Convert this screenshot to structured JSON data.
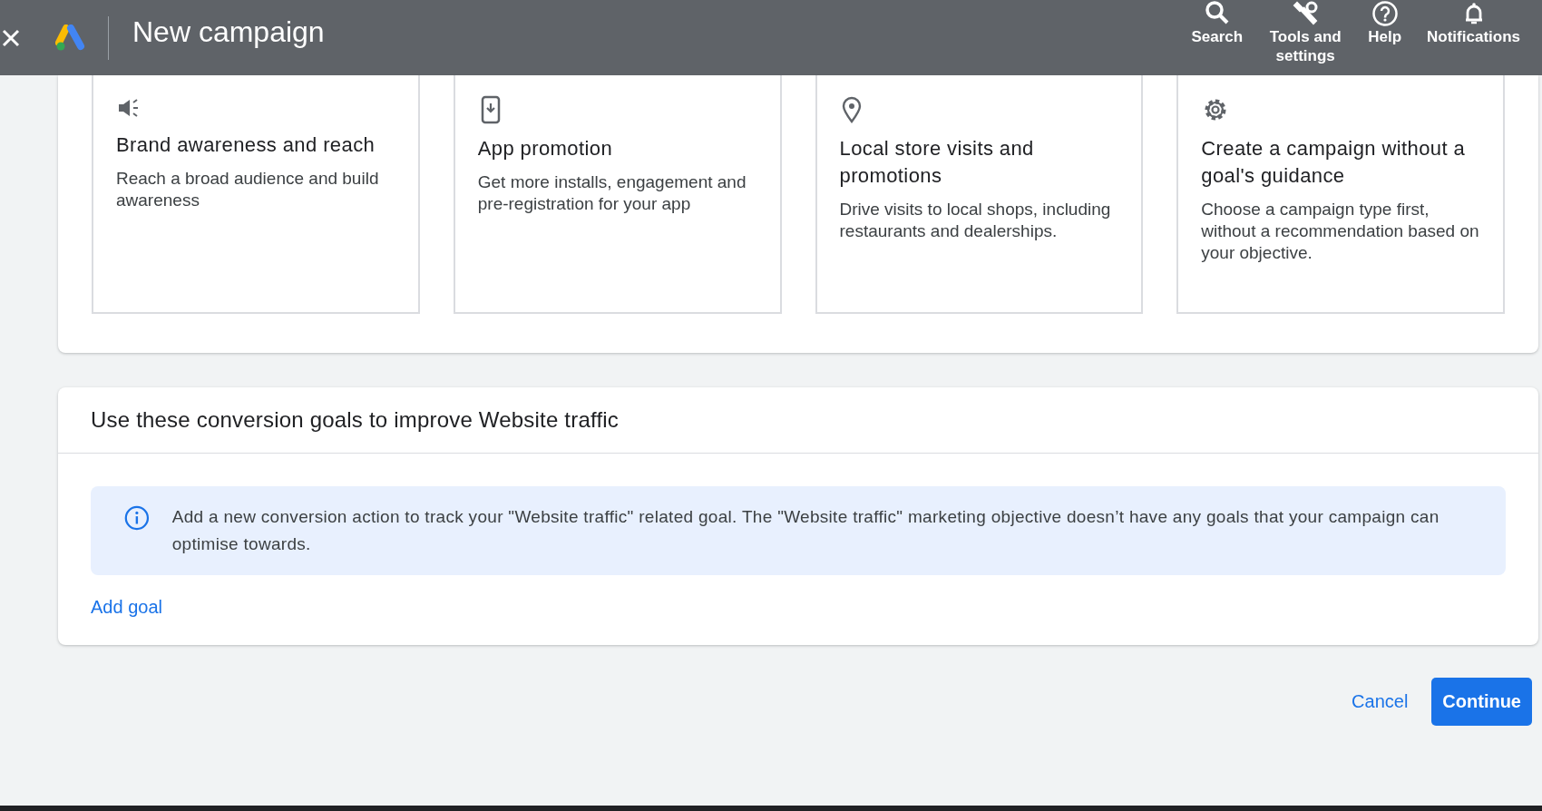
{
  "header": {
    "title": "New campaign",
    "actions": [
      {
        "kind": "search",
        "label": "Search"
      },
      {
        "kind": "tools",
        "label": "Tools and settings"
      },
      {
        "kind": "help",
        "label": "Help"
      },
      {
        "kind": "notifications",
        "label": "Notifications"
      }
    ]
  },
  "objectives": [
    {
      "kind": "megaphone",
      "title": "Brand awareness and reach",
      "description": "Reach a broad audience and build awareness"
    },
    {
      "kind": "phone",
      "title": "App promotion",
      "description": "Get more installs, engagement and pre-registration for your app"
    },
    {
      "kind": "pin",
      "title": "Local store visits and promotions",
      "description": "Drive visits to local shops, including restaurants and dealerships."
    },
    {
      "kind": "gear",
      "title": "Create a campaign without a goal's guidance",
      "description": "Choose a campaign type first, without a recommendation based on your objective."
    }
  ],
  "goals": {
    "title": "Use these conversion goals to improve Website traffic",
    "info": "Add a new conversion action to track your \"Website traffic\" related goal. The \"Website traffic\" marketing objective doesn’t have any goals that your campaign can optimise towards.",
    "link": "Add goal"
  },
  "buttons": {
    "cancel": "Cancel",
    "continue": "Continue"
  }
}
